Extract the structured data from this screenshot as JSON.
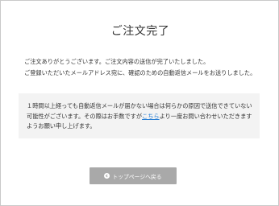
{
  "page": {
    "title": "ご注文完了"
  },
  "intro": {
    "line1": "ご注文ありがとうございます。ご注文内容の送信が完了いたしました。",
    "line2": "ご登録いただいたメールアドレス宛に、確認のための自動返信メールをお送りしました。"
  },
  "notice": {
    "text_before_link": "１時間以上経っても自動返信メールが届かない場合は何らかの原因で送信できていない可能性がございます。その際はお手数ですが",
    "link_label": "こちら",
    "text_after_link": "より一度お問い合わせいただきますようお願い申し上げます。"
  },
  "actions": {
    "back_to_top_label": "トップページへ戻る",
    "back_icon": "arrow-left-circle-icon"
  },
  "colors": {
    "link": "#2a7fd4",
    "button_bg": "#a9a9a9",
    "notice_bg": "#f3f3f3"
  }
}
